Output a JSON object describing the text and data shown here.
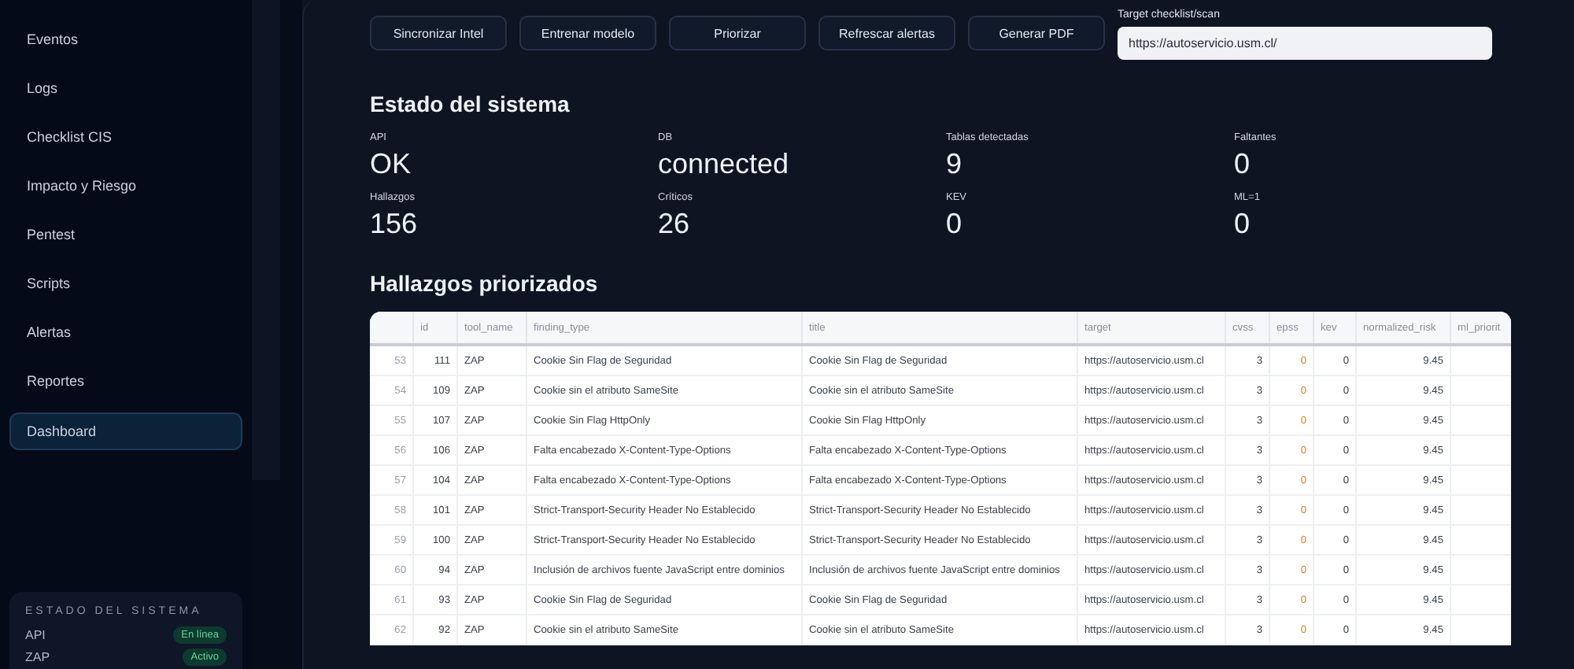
{
  "sidebar": {
    "items": [
      {
        "label": "Eventos",
        "selected": false
      },
      {
        "label": "Logs",
        "selected": false
      },
      {
        "label": "Checklist CIS",
        "selected": false
      },
      {
        "label": "Impacto y Riesgo",
        "selected": false
      },
      {
        "label": "Pentest",
        "selected": false
      },
      {
        "label": "Scripts",
        "selected": false
      },
      {
        "label": "Alertas",
        "selected": false
      },
      {
        "label": "Reportes",
        "selected": false
      },
      {
        "label": "Dashboard",
        "selected": true
      }
    ],
    "status": {
      "title": "ESTADO DEL SISTEMA",
      "items": [
        {
          "label": "API",
          "badge": "En línea"
        },
        {
          "label": "ZAP",
          "badge": "Activo"
        }
      ]
    }
  },
  "toolbar": {
    "buttons": [
      "Sincronizar Intel",
      "Entrenar modelo",
      "Priorizar",
      "Refrescar alertas",
      "Generar PDF"
    ],
    "target_field": {
      "label": "Target checklist/scan",
      "value": "https://autoservicio.usm.cl/"
    }
  },
  "system_status": {
    "title": "Estado del sistema",
    "metrics": [
      {
        "label": "API",
        "value": "OK"
      },
      {
        "label": "DB",
        "value": "connected"
      },
      {
        "label": "Tablas detectadas",
        "value": "9"
      },
      {
        "label": "Faltantes",
        "value": "0"
      },
      {
        "label": "Hallazgos",
        "value": "156"
      },
      {
        "label": "Críticos",
        "value": "26"
      },
      {
        "label": "KEV",
        "value": "0"
      },
      {
        "label": "ML=1",
        "value": "0"
      }
    ]
  },
  "findings": {
    "title": "Hallazgos priorizados",
    "columns": [
      "",
      "id",
      "tool_name",
      "finding_type",
      "title",
      "target",
      "cvss",
      "epss",
      "kev",
      "normalized_risk",
      "ml_priorit"
    ],
    "rows": [
      [
        "53",
        "111",
        "ZAP",
        "Cookie Sin Flag de Seguridad",
        "Cookie Sin Flag de Seguridad",
        "https://autoservicio.usm.cl",
        "3",
        "0",
        "0",
        "9.45"
      ],
      [
        "54",
        "109",
        "ZAP",
        "Cookie sin el atributo SameSite",
        "Cookie sin el atributo SameSite",
        "https://autoservicio.usm.cl",
        "3",
        "0",
        "0",
        "9.45"
      ],
      [
        "55",
        "107",
        "ZAP",
        "Cookie Sin Flag HttpOnly",
        "Cookie Sin Flag HttpOnly",
        "https://autoservicio.usm.cl",
        "3",
        "0",
        "0",
        "9.45"
      ],
      [
        "56",
        "106",
        "ZAP",
        "Falta encabezado X-Content-Type-Options",
        "Falta encabezado X-Content-Type-Options",
        "https://autoservicio.usm.cl",
        "3",
        "0",
        "0",
        "9.45"
      ],
      [
        "57",
        "104",
        "ZAP",
        "Falta encabezado X-Content-Type-Options",
        "Falta encabezado X-Content-Type-Options",
        "https://autoservicio.usm.cl",
        "3",
        "0",
        "0",
        "9.45"
      ],
      [
        "58",
        "101",
        "ZAP",
        "Strict-Transport-Security Header No Establecido",
        "Strict-Transport-Security Header No Establecido",
        "https://autoservicio.usm.cl",
        "3",
        "0",
        "0",
        "9.45"
      ],
      [
        "59",
        "100",
        "ZAP",
        "Strict-Transport-Security Header No Establecido",
        "Strict-Transport-Security Header No Establecido",
        "https://autoservicio.usm.cl",
        "3",
        "0",
        "0",
        "9.45"
      ],
      [
        "60",
        "94",
        "ZAP",
        "Inclusión de archivos fuente JavaScript entre dominios",
        "Inclusión de archivos fuente JavaScript entre dominios",
        "https://autoservicio.usm.cl",
        "3",
        "0",
        "0",
        "9.45"
      ],
      [
        "61",
        "93",
        "ZAP",
        "Cookie Sin Flag de Seguridad",
        "Cookie Sin Flag de Seguridad",
        "https://autoservicio.usm.cl",
        "3",
        "0",
        "0",
        "9.45"
      ],
      [
        "62",
        "92",
        "ZAP",
        "Cookie sin el atributo SameSite",
        "Cookie sin el atributo SameSite",
        "https://autoservicio.usm.cl",
        "3",
        "0",
        "0",
        "9.45"
      ]
    ]
  }
}
